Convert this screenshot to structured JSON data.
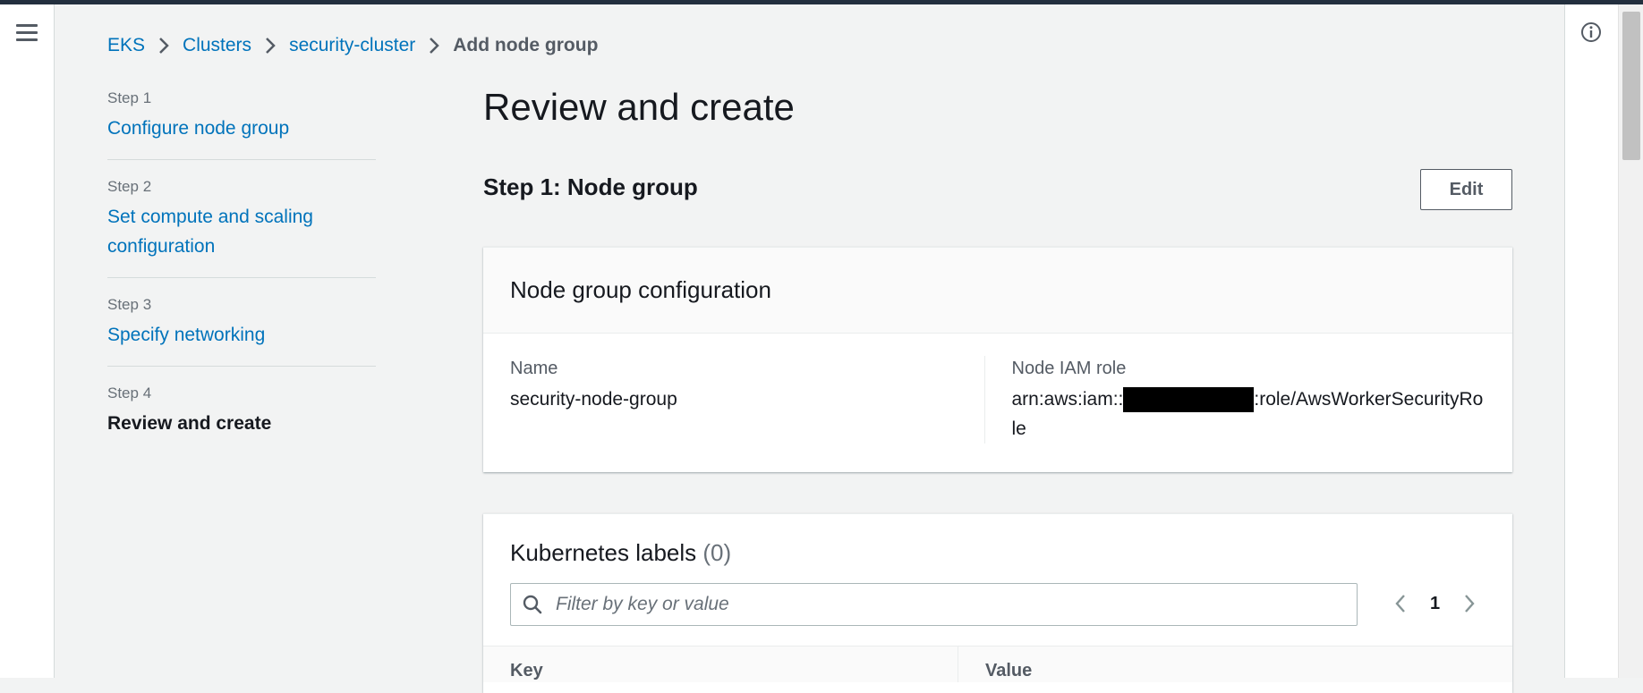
{
  "nav": {
    "menu_icon": "hamburger-icon",
    "info_icon": "info-icon"
  },
  "breadcrumb": {
    "items": [
      "EKS",
      "Clusters",
      "security-cluster"
    ],
    "current": "Add node group"
  },
  "steps": [
    {
      "number": "Step 1",
      "title": "Configure node group",
      "current": false
    },
    {
      "number": "Step 2",
      "title": "Set compute and scaling configuration",
      "current": false
    },
    {
      "number": "Step 3",
      "title": "Specify networking",
      "current": false
    },
    {
      "number": "Step 4",
      "title": "Review and create",
      "current": true
    }
  ],
  "main": {
    "title": "Review and create",
    "section_title": "Step 1: Node group",
    "edit_label": "Edit"
  },
  "node_group_config": {
    "header": "Node group configuration",
    "name_label": "Name",
    "name_value": "security-node-group",
    "role_label": "Node IAM role",
    "role_prefix": "arn:aws:iam::",
    "role_suffix": ":role/AwsWorkerSecurityRole"
  },
  "labels_card": {
    "title": "Kubernetes labels",
    "count": "(0)",
    "filter_placeholder": "Filter by key or value",
    "page": "1",
    "col_key": "Key",
    "col_value": "Value"
  },
  "colors": {
    "link": "#0073bb",
    "topbar": "#232f3e",
    "background": "#f2f3f3"
  }
}
